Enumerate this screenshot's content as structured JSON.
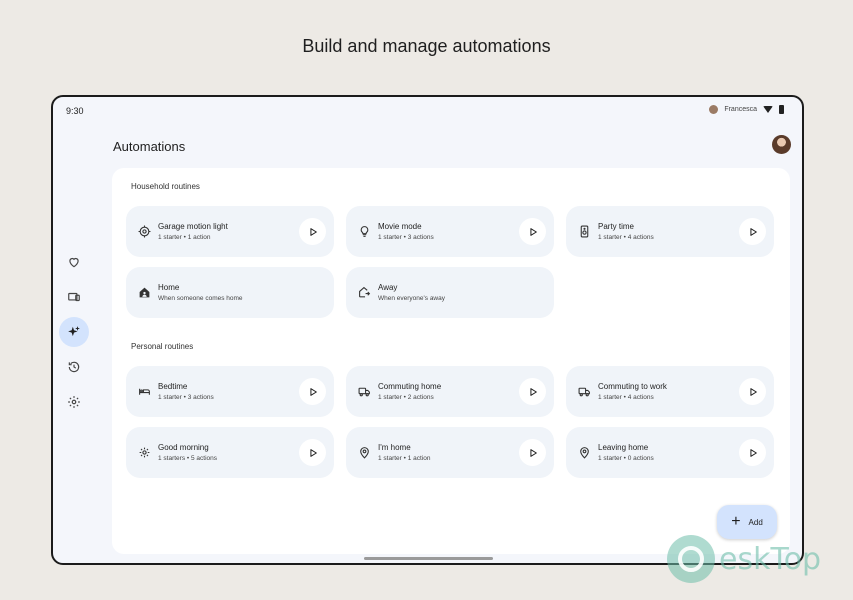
{
  "headline": "Build and manage automations",
  "status_bar": {
    "time": "9:30",
    "user": "Francesca"
  },
  "page_title": "Automations",
  "nav": [
    {
      "icon": "heart-icon",
      "active": false
    },
    {
      "icon": "devices-icon",
      "active": false
    },
    {
      "icon": "automations-sparkle-icon",
      "active": true
    },
    {
      "icon": "history-icon",
      "active": false
    },
    {
      "icon": "gear-icon",
      "active": false
    }
  ],
  "household": {
    "title": "Household routines",
    "routines": [
      {
        "name": "Garage motion light",
        "detail": "1 starter • 1 action",
        "icon": "motion-sensor-icon",
        "playable": true
      },
      {
        "name": "Movie mode",
        "detail": "1 starter • 3 actions",
        "icon": "lightbulb-icon",
        "playable": true
      },
      {
        "name": "Party time",
        "detail": "1 starter • 4 actions",
        "icon": "speaker-icon",
        "playable": true
      },
      {
        "name": "Home",
        "detail": "When someone comes home",
        "icon": "home-person-icon",
        "playable": false
      },
      {
        "name": "Away",
        "detail": "When everyone's away",
        "icon": "home-away-icon",
        "playable": false
      }
    ]
  },
  "personal": {
    "title": "Personal routines",
    "routines": [
      {
        "name": "Bedtime",
        "detail": "1 starter • 3 actions",
        "icon": "bed-icon",
        "playable": true
      },
      {
        "name": "Commuting home",
        "detail": "1 starter • 2 actions",
        "icon": "car-commute-icon",
        "playable": true
      },
      {
        "name": "Commuting to work",
        "detail": "1 starter • 4 actions",
        "icon": "car-commute-icon",
        "playable": true
      },
      {
        "name": "Good morning",
        "detail": "1 starters • 5 actions",
        "icon": "sun-icon",
        "playable": true
      },
      {
        "name": "I'm home",
        "detail": "1 starter • 1 action",
        "icon": "location-pin-icon",
        "playable": true
      },
      {
        "name": "Leaving home",
        "detail": "1 starter • 0 actions",
        "icon": "location-pin-icon",
        "playable": true
      }
    ]
  },
  "fab": {
    "label": "Add"
  },
  "watermark": {
    "text": "eskTop"
  }
}
